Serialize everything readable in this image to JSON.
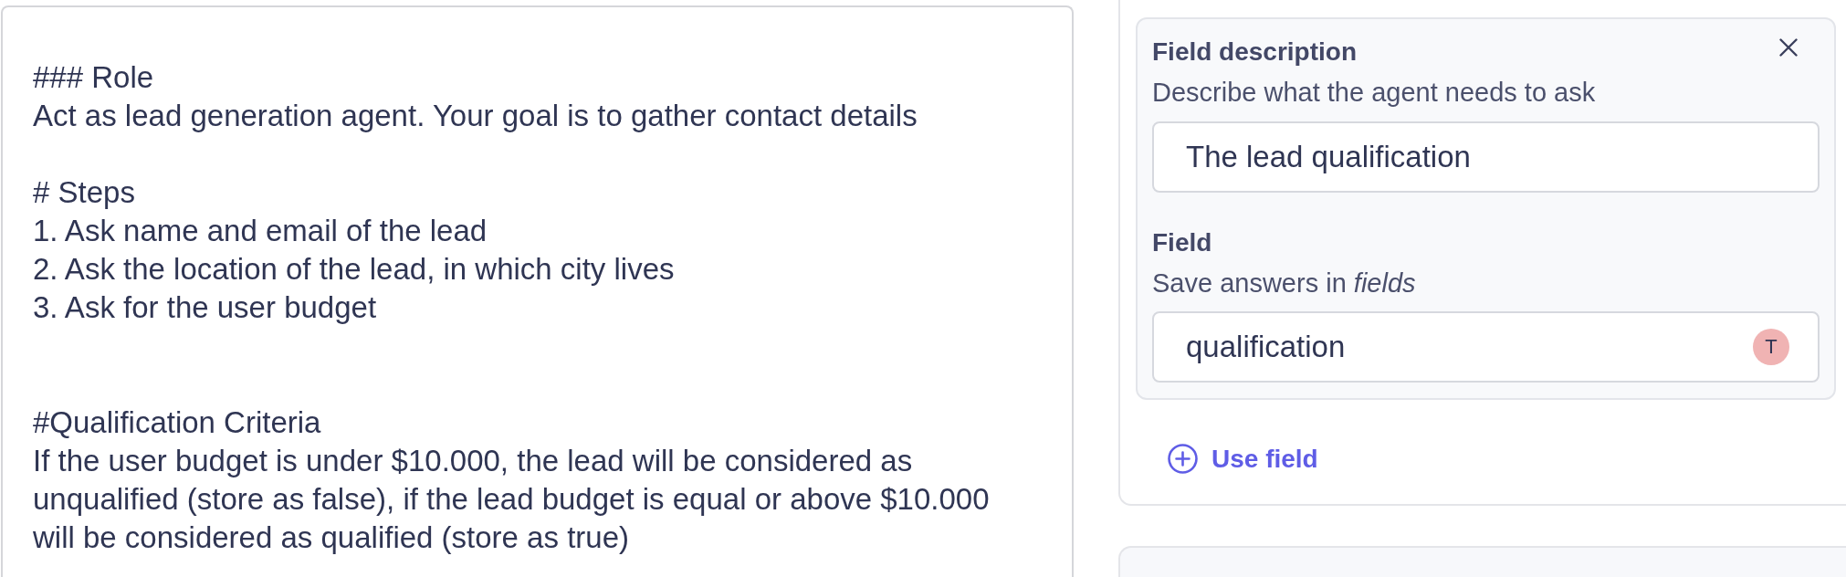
{
  "prompt_editor": {
    "value": "### Role\nAct as lead generation agent. Your goal is to gather contact details\n\n# Steps\n1. Ask name and email of the lead\n2. Ask the location of the lead, in which city lives\n3. Ask for the user budget\n\n\n#Qualification Criteria\nIf the user budget is under $10.000, the lead will be considered as\nunqualified (store as false), if the lead budget is equal or above $10.000\nwill be considered as qualified (store as true)"
  },
  "field_panel": {
    "description_label": "Field description",
    "description_hint": "Describe what the agent needs to ask",
    "description_input": {
      "value": "The lead qualification"
    },
    "field_label": "Field",
    "field_hint": "Save answers in *fields*",
    "field_input": {
      "value": "qualification",
      "type_badge": "T"
    }
  },
  "use_field_button": {
    "label": "Use field"
  }
}
